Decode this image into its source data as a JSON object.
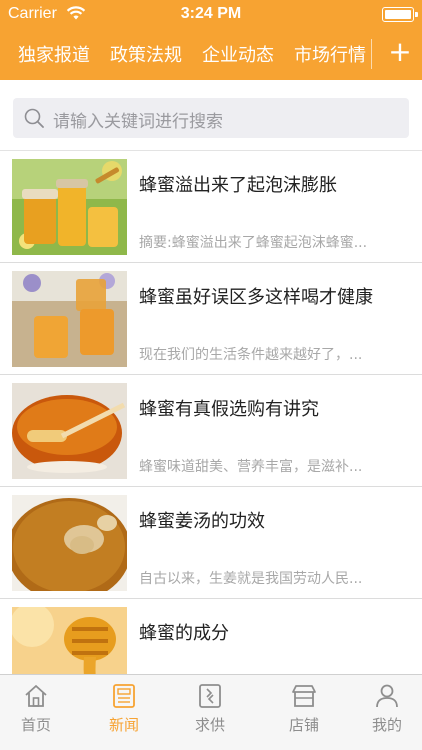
{
  "status_bar": {
    "carrier": "Carrier",
    "time": "3:24 PM"
  },
  "tabs": [
    {
      "label": "独家报道"
    },
    {
      "label": "政策法规"
    },
    {
      "label": "企业动态"
    },
    {
      "label": "市场行情"
    }
  ],
  "add_tab_symbol": "+",
  "search": {
    "placeholder": "请输入关键词进行搜索"
  },
  "articles": [
    {
      "title": "蜂蜜溢出来了起泡沫膨胀",
      "summary": "摘要:蜂蜜溢出来了蜂蜜起泡沫蜂蜜..."
    },
    {
      "title": "蜂蜜虽好误区多这样喝才健康",
      "summary": "现在我们的生活条件越来越好了，..."
    },
    {
      "title": "蜂蜜有真假选购有讲究",
      "summary": "蜂蜜味道甜美、营养丰富，是滋补..."
    },
    {
      "title": "蜂蜜姜汤的功效",
      "summary": "自古以来，生姜就是我国劳动人民..."
    },
    {
      "title": "蜂蜜的成分",
      "summary": ""
    }
  ],
  "bottom_nav": [
    {
      "label": "首页",
      "icon": "home-icon"
    },
    {
      "label": "新闻",
      "icon": "news-icon",
      "active": true
    },
    {
      "label": "求供",
      "icon": "supply-demand-icon"
    },
    {
      "label": "店铺",
      "icon": "store-icon"
    },
    {
      "label": "我的",
      "icon": "profile-icon"
    }
  ],
  "colors": {
    "accent": "#f7a332",
    "inactive": "#8e8e8e"
  }
}
